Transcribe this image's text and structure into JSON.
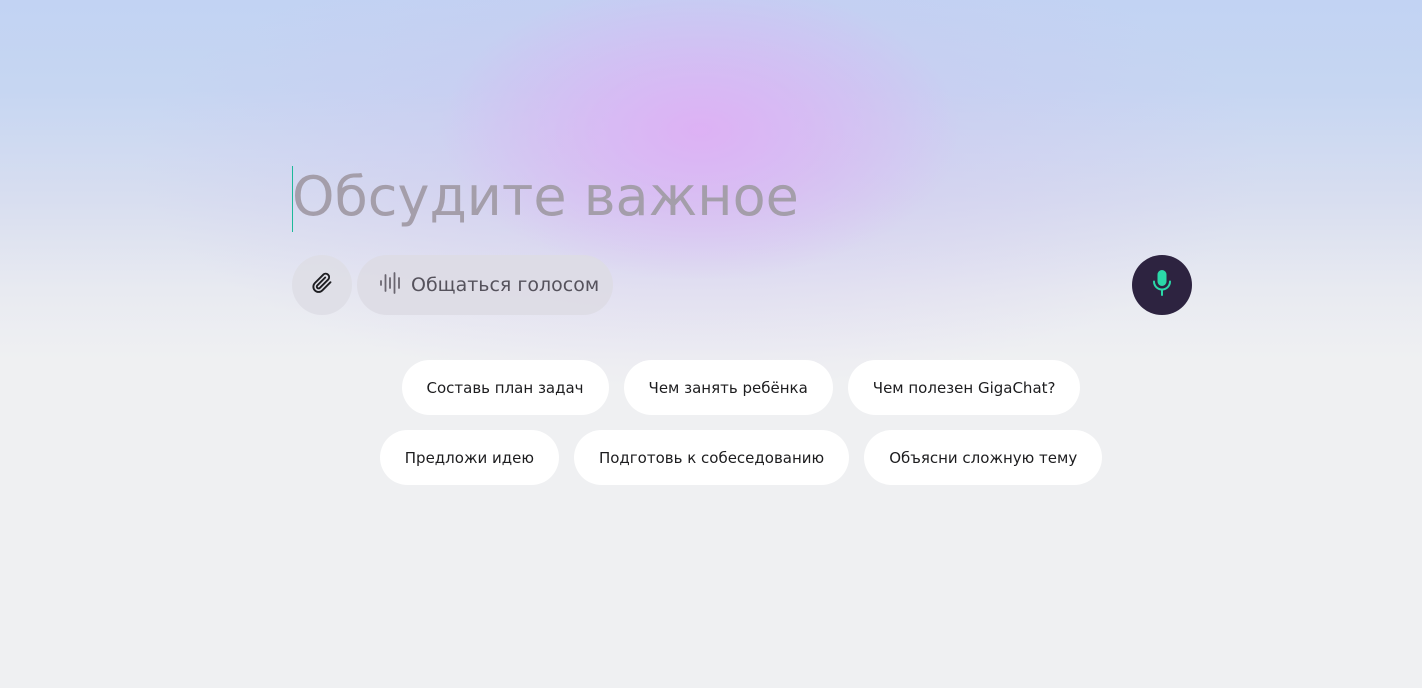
{
  "composer": {
    "placeholder": "Обсудите важное",
    "attach_icon": "paperclip-icon",
    "voice_chat_label": "Общаться голосом",
    "voice_chat_icon": "sound-wave-icon",
    "mic_icon": "microphone-icon"
  },
  "suggestions": [
    "Составь план задач",
    "Чем занять ребёнка",
    "Чем полезен GigaChat?",
    "Предложи идею",
    "Подготовь к собеседованию",
    "Объясни сложную тему"
  ],
  "colors": {
    "accent": "#2bd8a8",
    "mic_button_bg": "#2d2340",
    "background": "#eff0f2"
  }
}
